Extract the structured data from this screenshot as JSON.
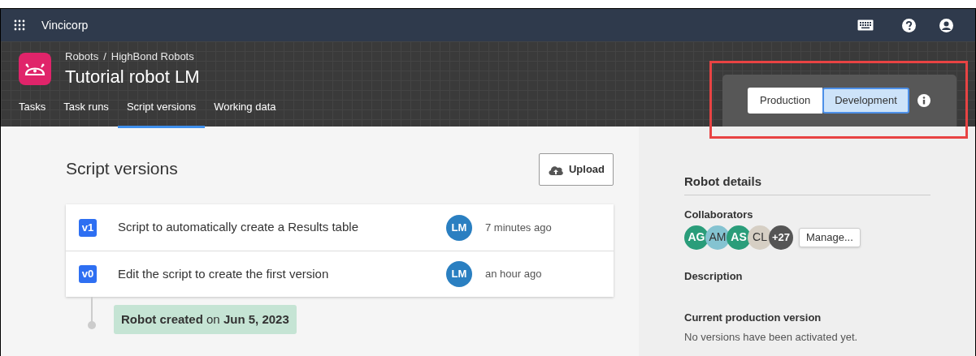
{
  "top_bar": {
    "org": "Vincicorp"
  },
  "header": {
    "breadcrumb": [
      "Robots",
      "HighBond Robots"
    ],
    "separator": "/",
    "title": "Tutorial robot LM",
    "tabs": [
      {
        "label": "Tasks",
        "selected": false
      },
      {
        "label": "Task runs",
        "selected": false
      },
      {
        "label": "Script versions",
        "selected": true
      },
      {
        "label": "Working data",
        "selected": false
      }
    ],
    "environment": [
      {
        "label": "Production",
        "selected": false
      },
      {
        "label": "Development",
        "selected": true
      }
    ],
    "highlighted": true
  },
  "main": {
    "title": "Script versions",
    "upload_button": "Upload",
    "versions": [
      {
        "tag": "v1",
        "message": "Script to automatically create a Results table",
        "author": "LM",
        "time": "7 minutes ago"
      },
      {
        "tag": "v0",
        "message": "Edit the script to create the first version",
        "author": "LM",
        "time": "an hour ago"
      }
    ],
    "created_note": "**Robot created** on **Jun 5, 2023**"
  },
  "details": {
    "title": "Robot details",
    "collaborators_label": "Collaborators",
    "collaborators": [
      {
        "initials": "AG",
        "color": "#2a9d7a"
      },
      {
        "initials": "AM",
        "color": "#84c3d1"
      },
      {
        "initials": "AS",
        "color": "#2a9d7a"
      },
      {
        "initials": "CL",
        "color": "#d6cfc4"
      }
    ],
    "more_count": "+27",
    "manage_button": "Manage...",
    "description_label": "Description",
    "production_label": "Current production version",
    "production_value": "No versions have been activated yet."
  }
}
